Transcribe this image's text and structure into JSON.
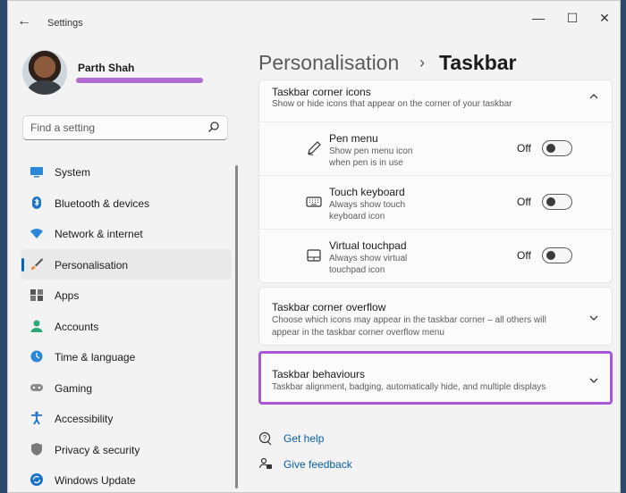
{
  "window": {
    "title": "Settings",
    "back_glyph": "←",
    "min_glyph": "—",
    "max_glyph": "☐",
    "close_glyph": "✕"
  },
  "user": {
    "name": "Parth Shah"
  },
  "search": {
    "placeholder": "Find a setting"
  },
  "nav": {
    "items": [
      {
        "label": "System",
        "icon": "system-icon"
      },
      {
        "label": "Bluetooth & devices",
        "icon": "bluetooth-icon"
      },
      {
        "label": "Network & internet",
        "icon": "wifi-icon"
      },
      {
        "label": "Personalisation",
        "icon": "brush-icon",
        "active": true
      },
      {
        "label": "Apps",
        "icon": "apps-icon"
      },
      {
        "label": "Accounts",
        "icon": "accounts-icon"
      },
      {
        "label": "Time & language",
        "icon": "globe-clock-icon"
      },
      {
        "label": "Gaming",
        "icon": "gamepad-icon"
      },
      {
        "label": "Accessibility",
        "icon": "accessibility-icon"
      },
      {
        "label": "Privacy & security",
        "icon": "shield-icon"
      },
      {
        "label": "Windows Update",
        "icon": "update-icon"
      }
    ]
  },
  "breadcrumb": {
    "parent": "Personalisation",
    "separator": "›",
    "current": "Taskbar"
  },
  "corner_icons": {
    "title": "Taskbar corner icons",
    "subtitle": "Show or hide icons that appear on the corner of your taskbar",
    "items": [
      {
        "title": "Pen menu",
        "desc_1": "Show pen menu icon",
        "desc_2": "when pen is in use",
        "state": "Off",
        "icon": "pen-icon"
      },
      {
        "title": "Touch keyboard",
        "desc_1": "Always show touch",
        "desc_2": "keyboard icon",
        "state": "Off",
        "icon": "keyboard-icon"
      },
      {
        "title": "Virtual touchpad",
        "desc_1": "Always show virtual",
        "desc_2": "touchpad icon",
        "state": "Off",
        "icon": "touchpad-icon"
      }
    ]
  },
  "corner_overflow": {
    "title": "Taskbar corner overflow",
    "subtitle_1": "Choose which icons may appear in the taskbar corner – all others will",
    "subtitle_2": "appear in the taskbar corner overflow menu"
  },
  "behaviours": {
    "title": "Taskbar behaviours",
    "subtitle": "Taskbar alignment, badging, automatically hide, and multiple displays"
  },
  "links": {
    "help": "Get help",
    "feedback": "Give feedback"
  },
  "colors": {
    "accent": "#0067c0",
    "highlight": "#a855d6",
    "link": "#0a5ea8"
  }
}
